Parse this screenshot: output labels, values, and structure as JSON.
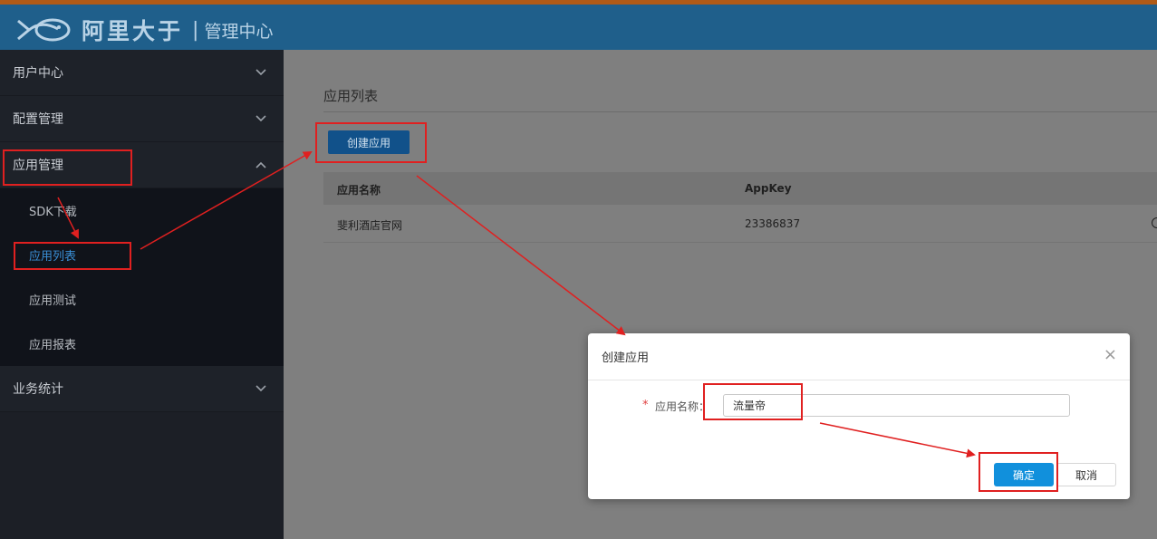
{
  "header": {
    "brand_name": "阿里大于",
    "separator": "|",
    "subtitle": "管理中心",
    "background_color": "#1f5f8b",
    "accent_stripe_color": "#b05a16"
  },
  "sidebar": {
    "menus": [
      {
        "label": "用户中心",
        "expanded": false,
        "icon": "chevron-down-icon"
      },
      {
        "label": "配置管理",
        "expanded": false,
        "icon": "chevron-down-icon"
      },
      {
        "label": "应用管理",
        "expanded": true,
        "icon": "chevron-up-icon"
      },
      {
        "label": "业务统计",
        "expanded": false,
        "icon": "chevron-down-icon"
      }
    ],
    "app_submenu": [
      {
        "label": "SDK下载",
        "active": false
      },
      {
        "label": "应用列表",
        "active": true
      },
      {
        "label": "应用测试",
        "active": false
      },
      {
        "label": "应用报表",
        "active": false
      }
    ]
  },
  "main": {
    "page_title": "应用列表",
    "create_button": "创建应用",
    "table": {
      "columns": [
        "应用名称",
        "AppKey"
      ],
      "rows": [
        {
          "name": "斐利酒店官网",
          "appkey": "23386837"
        }
      ]
    }
  },
  "dialog": {
    "title": "创建应用",
    "close_icon": "close-icon",
    "required_mark": "*",
    "field_label": "应用名称：",
    "field_value": "流量帝",
    "ok_button": "确定",
    "cancel_button": "取消",
    "ok_color": "#1190dc"
  },
  "annotations": {
    "highlight_color": "#e02020"
  }
}
